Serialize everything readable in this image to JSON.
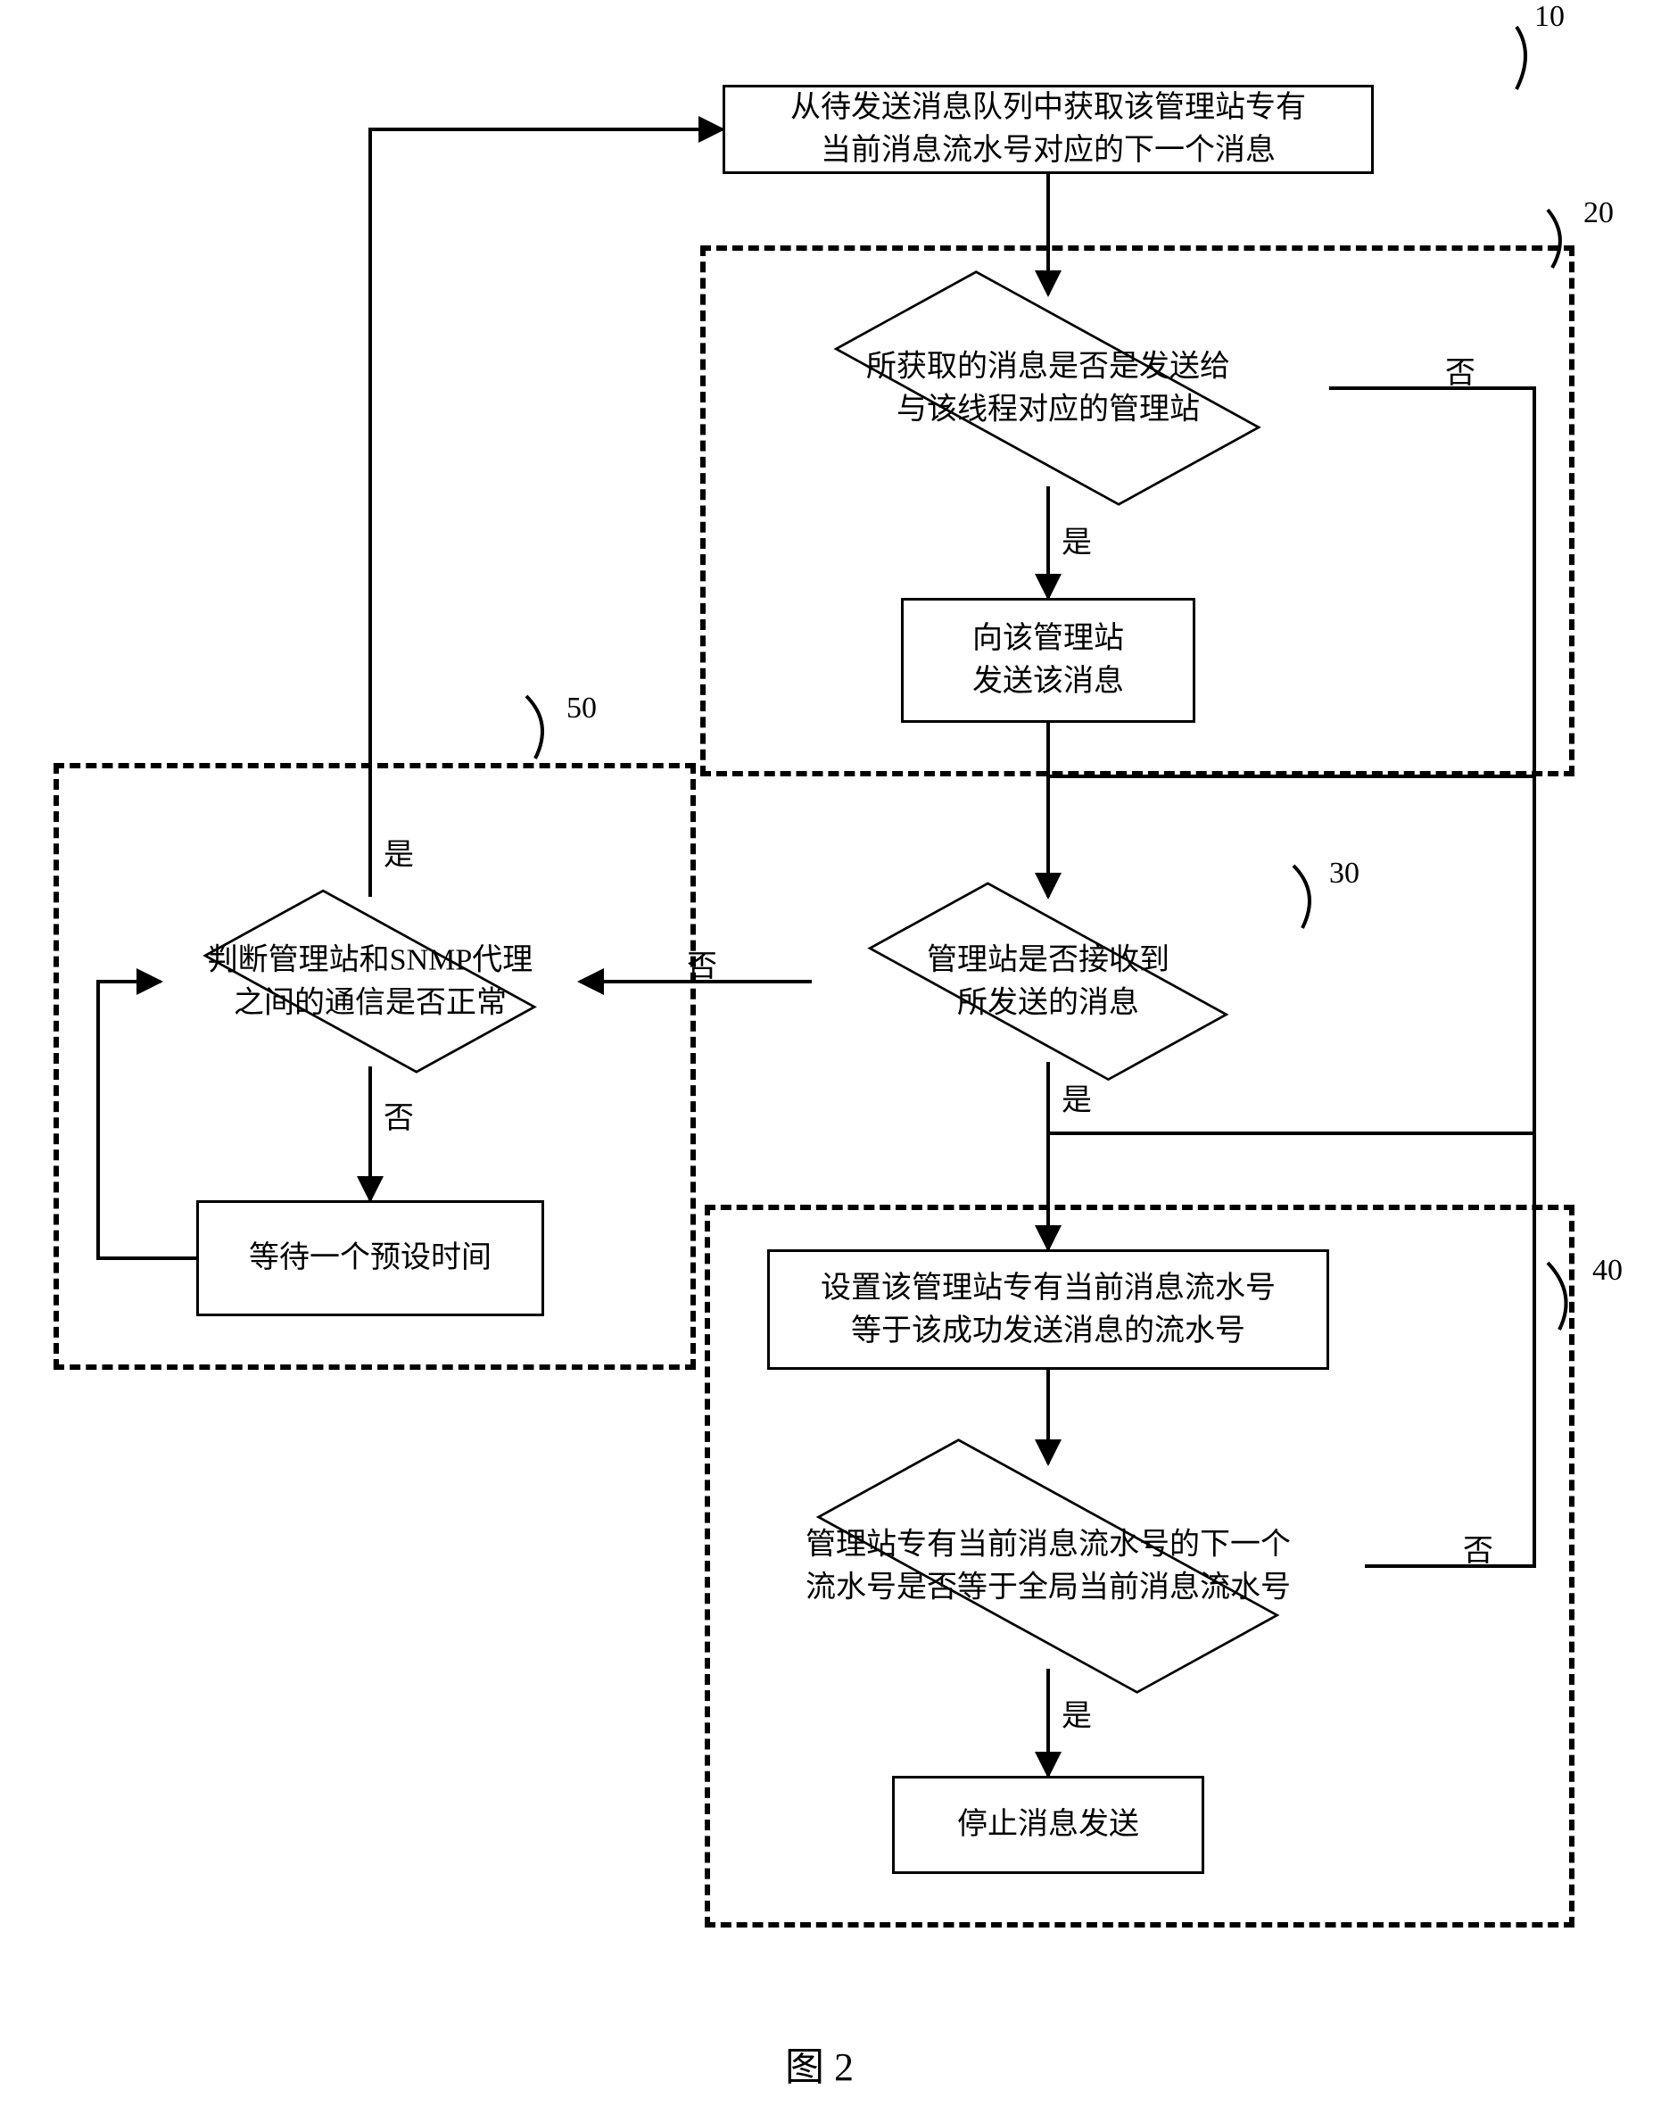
{
  "nodes": {
    "n10": {
      "num": "10",
      "text": "从待发送消息队列中获取该管理站专有\n当前消息流水号对应的下一个消息"
    },
    "n20": {
      "num": "20",
      "d1": "所获取的消息是否是发送给\n与该线程对应的管理站",
      "b1": "向该管理站\n发送该消息"
    },
    "n30": {
      "num": "30",
      "d1": "管理站是否接收到\n所发送的消息"
    },
    "n40": {
      "num": "40",
      "b1": "设置该管理站专有当前消息流水号\n等于该成功发送消息的流水号",
      "d1": "管理站专有当前消息流水号的下一个\n流水号是否等于全局当前消息流水号",
      "b2": "停止消息发送"
    },
    "n50": {
      "num": "50",
      "d1": "判断管理站和SNMP代理\n之间的通信是否正常",
      "b1": "等待一个预设时间"
    }
  },
  "labels": {
    "yes": "是",
    "no": "否"
  },
  "figure": "图 2"
}
